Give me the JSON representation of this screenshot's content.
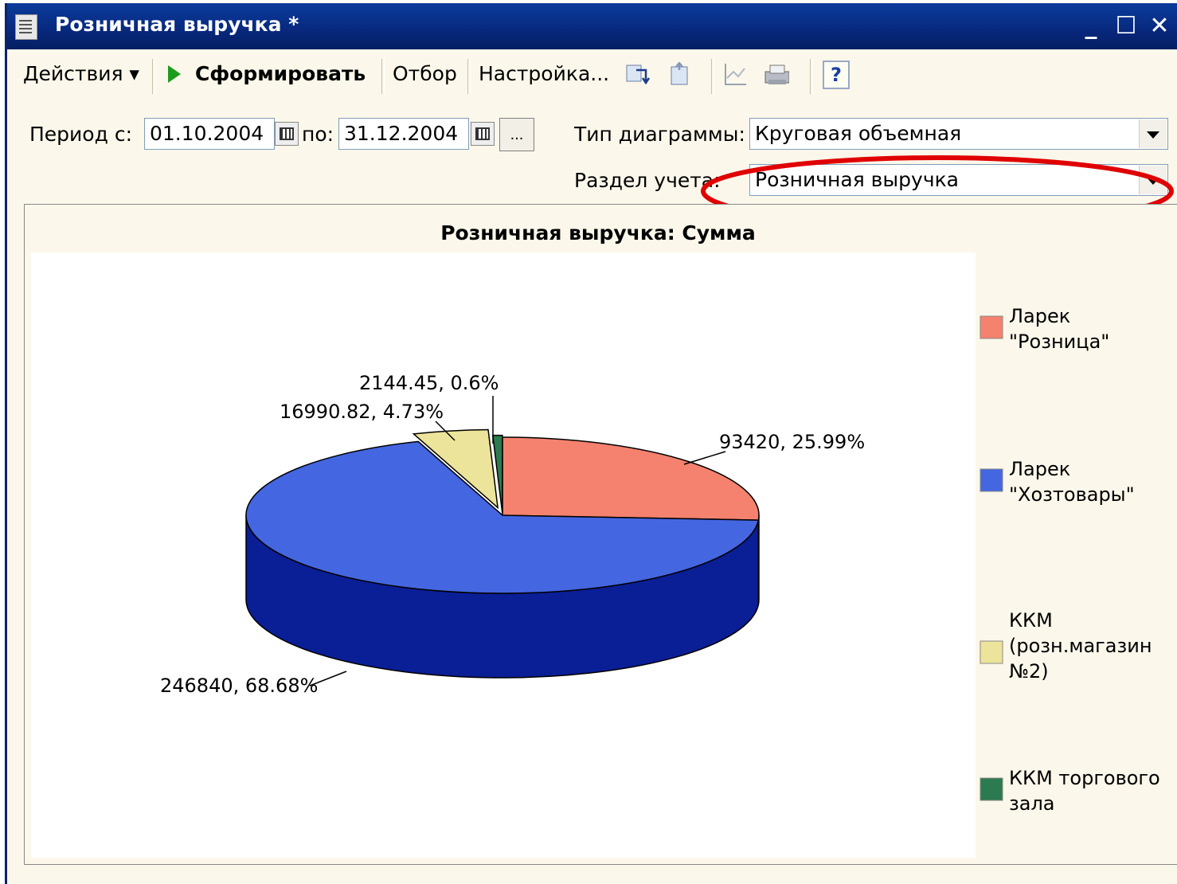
{
  "window": {
    "title": "Розничная выручка *",
    "controls": [
      "_",
      "☐",
      "✕"
    ]
  },
  "toolbar": {
    "actions_label": "Действия ▾",
    "generate_label": "Сформировать",
    "filter_label": "Отбор",
    "settings_label": "Настройка...",
    "help_label": "?"
  },
  "form": {
    "period_from_label": "Период с:",
    "period_from_value": "01.10.2004",
    "period_to_label": "по:",
    "period_to_value": "31.12.2004",
    "period_more_label": "...",
    "chart_type_label": "Тип диаграммы:",
    "chart_type_value": "Круговая объемная",
    "section_label": "Раздел учета:",
    "section_value": "Розничная выручка"
  },
  "colors": {
    "highlight_ellipse": "#e00000",
    "title_bar": "#0a3c9c"
  },
  "chart_data": {
    "type": "pie",
    "title": "Розничная выручка: Сумма",
    "three_d": true,
    "legend_position": "right",
    "slices": [
      {
        "name": "Ларек \"Розница\"",
        "legend_lines": [
          "Ларек",
          "\"Розница\""
        ],
        "value": 93420,
        "percent": 25.99,
        "label": "93420, 25.99%",
        "color": "#f4826e",
        "side_color": "#c8503c"
      },
      {
        "name": "Ларек \"Хозтовары\"",
        "legend_lines": [
          "Ларек",
          "\"Хозтовары\""
        ],
        "value": 246840,
        "percent": 68.68,
        "label": "246840, 68.68%",
        "color": "#4466e0",
        "side_color": "#0a1e96"
      },
      {
        "name": "ККМ (розн.магазин №2)",
        "legend_lines": [
          "ККМ",
          "(розн.магазин",
          "№2)"
        ],
        "value": 16990.82,
        "percent": 4.73,
        "label": "16990.82, 4.73%",
        "color": "#ece49a",
        "side_color": "#b8ae5a"
      },
      {
        "name": "ККМ торгового зала",
        "legend_lines": [
          "ККМ торгового",
          "зала"
        ],
        "value": 2144.45,
        "percent": 0.6,
        "label": "2144.45, 0.6%",
        "color": "#2c7a50",
        "side_color": "#1a5034"
      }
    ]
  }
}
